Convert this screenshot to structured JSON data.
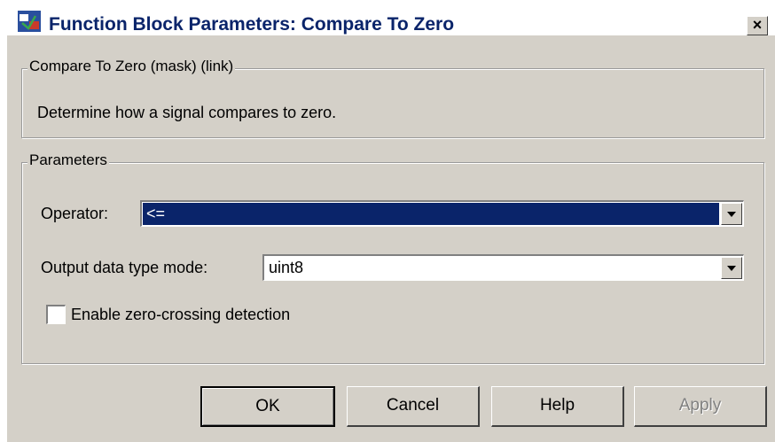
{
  "window": {
    "title": "Function Block Parameters: Compare To Zero",
    "close_glyph": "×",
    "icon": "simulink-block-icon"
  },
  "mask_group": {
    "legend": "Compare To Zero (mask) (link)",
    "description": "Determine how a signal compares to zero."
  },
  "params_group": {
    "legend": "Parameters",
    "operator": {
      "label": "Operator:",
      "value": "<=",
      "selected": true
    },
    "output_type": {
      "label": "Output data type mode:",
      "value": "uint8"
    },
    "zero_crossing": {
      "label": "Enable zero-crossing detection",
      "checked": false
    }
  },
  "buttons": {
    "ok": "OK",
    "cancel": "Cancel",
    "help": "Help",
    "apply": "Apply"
  },
  "colors": {
    "dialog_bg": "#d4d0c8",
    "title_text": "#0a246a",
    "selection_bg": "#0a246a"
  }
}
